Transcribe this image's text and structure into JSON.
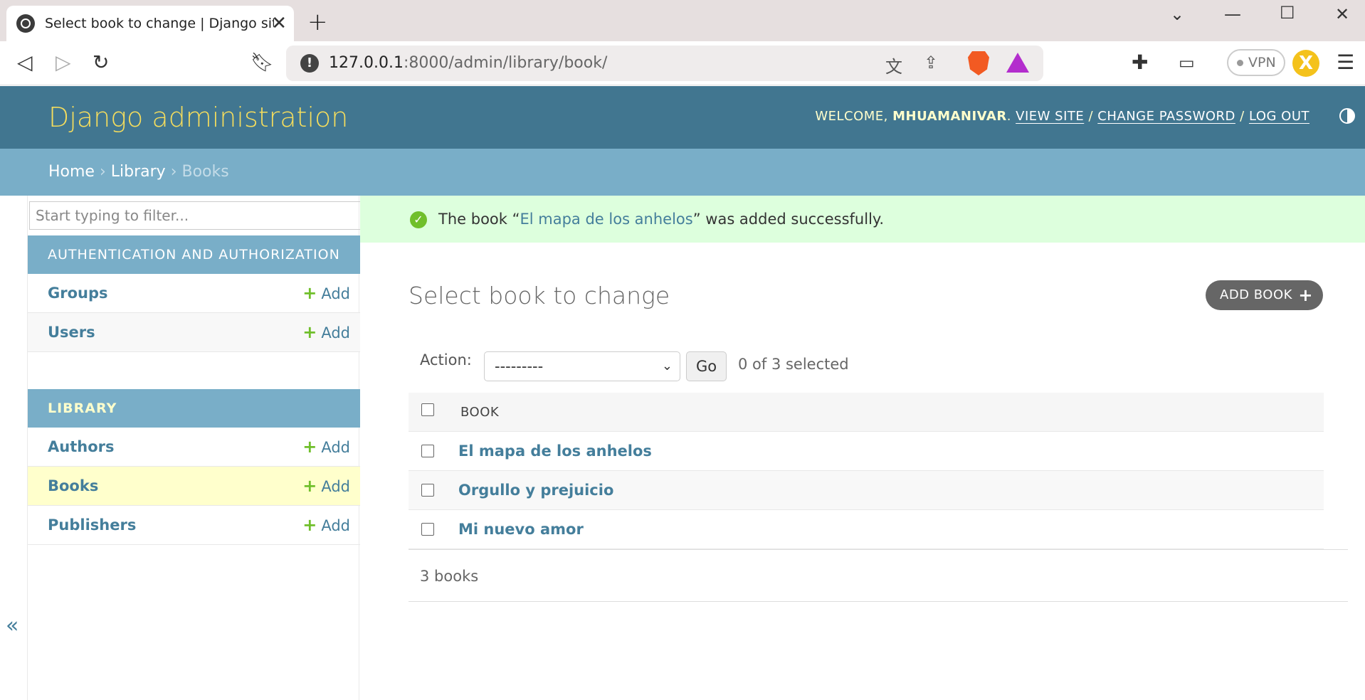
{
  "browser": {
    "tab_title": "Select book to change | Django site admin",
    "url_host": "127.0.0.1",
    "url_path": ":8000/admin/library/book/",
    "vpn_label": "VPN",
    "avatar_letter": "X"
  },
  "header": {
    "site_name": "Django administration",
    "welcome": "WELCOME, ",
    "username": "MHUAMANIVAR",
    "view_site": "VIEW SITE",
    "change_password": "CHANGE PASSWORD",
    "log_out": "LOG OUT",
    "separator": " / "
  },
  "breadcrumbs": {
    "home": "Home",
    "library": "Library",
    "current": "Books",
    "sep": " › "
  },
  "sidebar": {
    "filter_placeholder": "Start typing to filter...",
    "apps": [
      {
        "caption": "AUTHENTICATION AND AUTHORIZATION",
        "models": [
          {
            "name": "Groups",
            "add": "Add"
          },
          {
            "name": "Users",
            "add": "Add"
          }
        ]
      },
      {
        "caption": "LIBRARY",
        "models": [
          {
            "name": "Authors",
            "add": "Add"
          },
          {
            "name": "Books",
            "add": "Add"
          },
          {
            "name": "Publishers",
            "add": "Add"
          }
        ]
      }
    ],
    "collapse": "«"
  },
  "message": {
    "prefix": "The book “",
    "link": "El mapa de los anhelos",
    "suffix": "” was added successfully."
  },
  "content": {
    "title": "Select book to change",
    "add_button": "ADD BOOK",
    "action_label": "Action:",
    "action_selected": "---------",
    "go": "Go",
    "selection_count": "0 of 3 selected",
    "column_header": "BOOK",
    "rows": [
      "El mapa de los anhelos",
      "Orgullo y prejuicio",
      "Mi nuevo amor"
    ],
    "paginator": "3 books"
  },
  "colors": {
    "header_bg": "#417690",
    "breadcrumb_bg": "#79aec8",
    "branding": "#f5dd5d",
    "link": "#447e9b",
    "success_bg": "#ddffdd",
    "current_model_bg": "#ffffcc"
  }
}
